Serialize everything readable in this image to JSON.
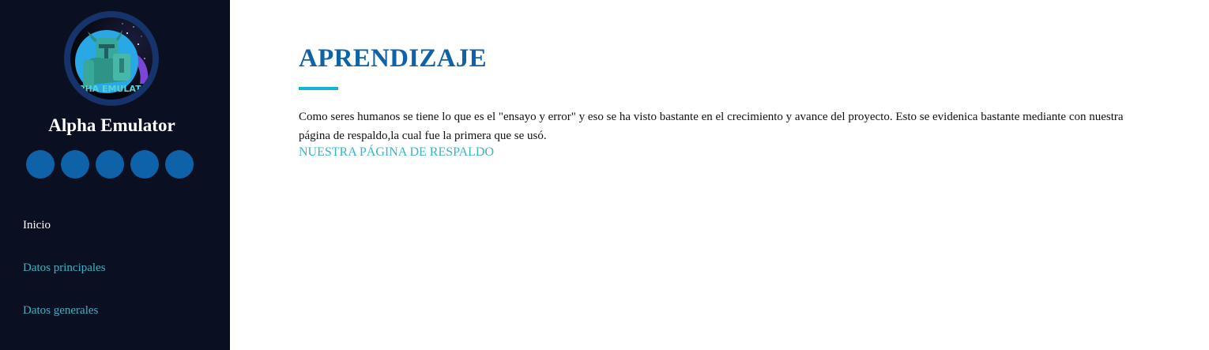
{
  "sidebar": {
    "avatar_text": "PHA EMULAT",
    "site_name": "Alpha Emulator",
    "social_icons": [
      "social-icon-1",
      "social-icon-2",
      "social-icon-3",
      "social-icon-4",
      "social-icon-5"
    ],
    "nav": [
      {
        "label": "Inicio",
        "active": true
      },
      {
        "label": "Datos principales",
        "active": false
      },
      {
        "label": "Datos generales",
        "active": false
      }
    ]
  },
  "main": {
    "title": "APRENDIZAJE",
    "paragraph": "Como seres humanos se tiene lo que es el \"ensayo y error\" y eso se ha visto bastante en el crecimiento y avance del proyecto. Esto se evidenica bastante mediante con nuestra página de respaldo,la cual fue la primera que se usó.",
    "link_label": "NUESTRA PÁGINA DE RESPALDO"
  },
  "colors": {
    "sidebar_bg": "#0b0f22",
    "accent_blue": "#0e62a8",
    "accent_cyan": "#12b6d4",
    "link": "#3bb3c3"
  }
}
